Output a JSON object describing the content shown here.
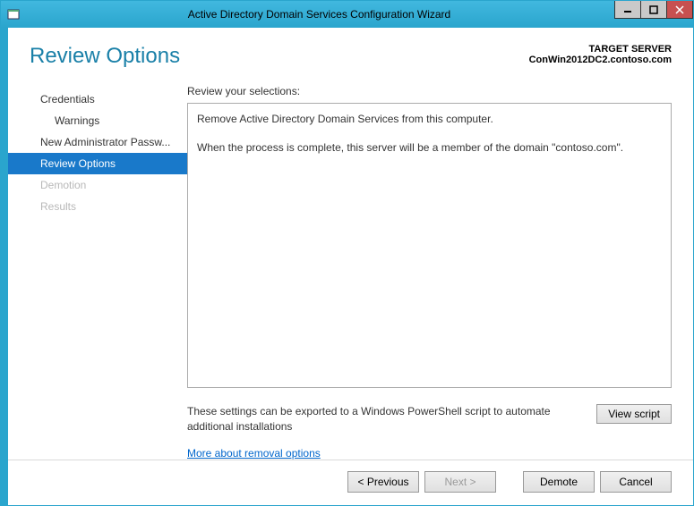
{
  "titlebar": {
    "title": "Active Directory Domain Services Configuration Wizard"
  },
  "header": {
    "page_title": "Review Options",
    "target_label": "TARGET SERVER",
    "target_name": "ConWin2012DC2.contoso.com"
  },
  "sidebar": {
    "items": [
      {
        "label": "Credentials"
      },
      {
        "label": "Warnings"
      },
      {
        "label": "New Administrator Passw..."
      },
      {
        "label": "Review Options"
      },
      {
        "label": "Demotion"
      },
      {
        "label": "Results"
      }
    ]
  },
  "review": {
    "heading": "Review your selections:",
    "line1": "Remove Active Directory Domain Services from this computer.",
    "line2": "When the process is complete, this server will be a member of the domain \"contoso.com\"."
  },
  "export": {
    "text": "These settings can be exported to a Windows PowerShell script to automate additional installations",
    "button": "View script"
  },
  "link": "More about removal options",
  "footer": {
    "previous": "< Previous",
    "next": "Next >",
    "demote": "Demote",
    "cancel": "Cancel"
  }
}
